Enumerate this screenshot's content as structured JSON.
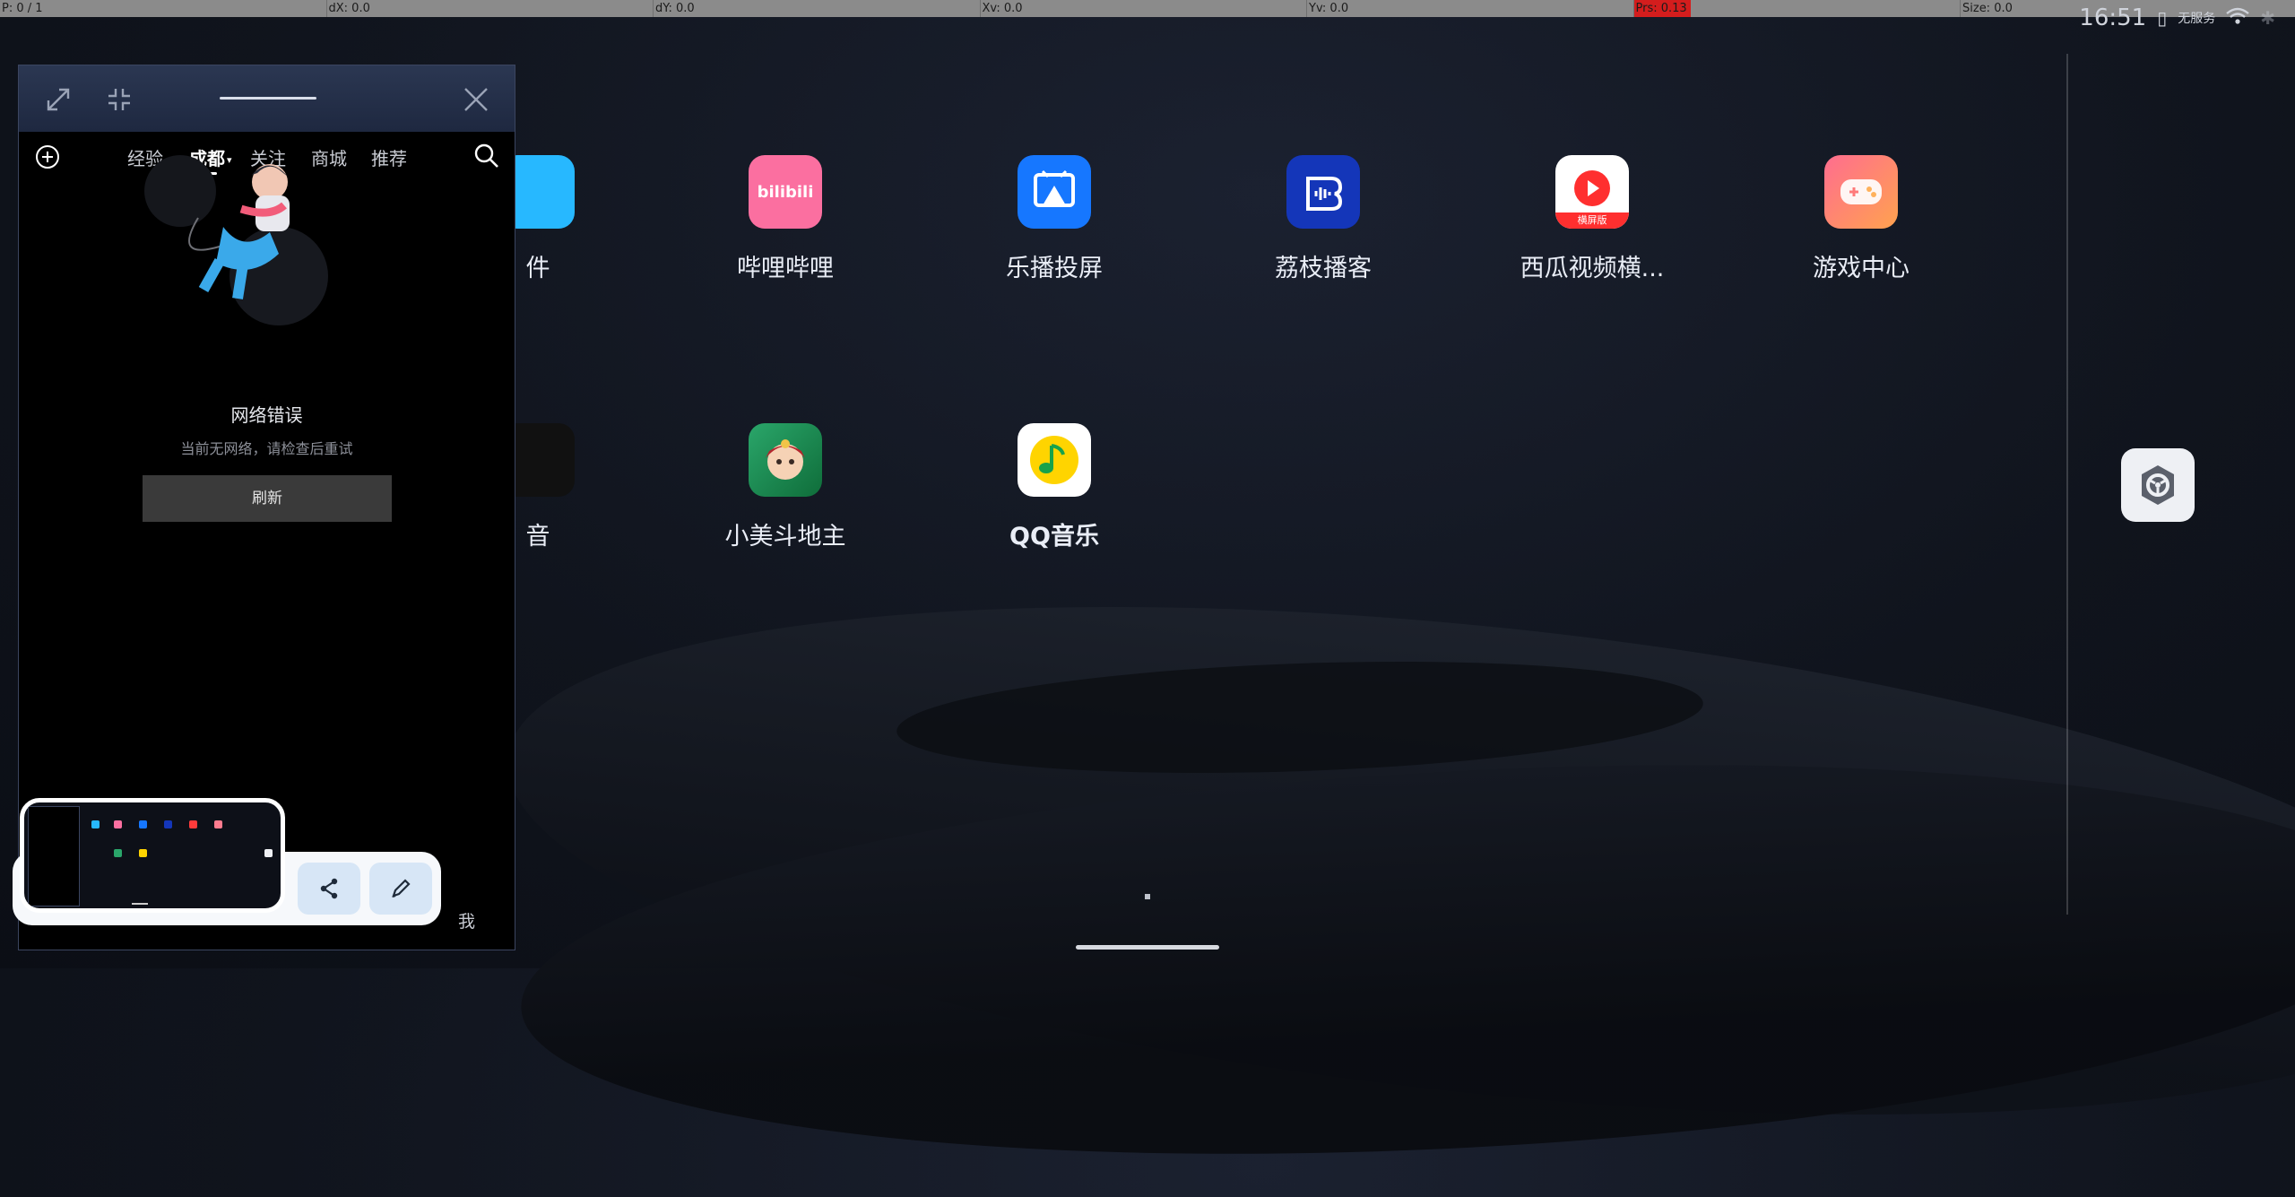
{
  "debug_bar": {
    "p": "P: 0 / 1",
    "dx": "dX: 0.0",
    "dy": "dY: 0.0",
    "xv": "Xv: 0.0",
    "yv": "Yv: 0.0",
    "prs": "Prs: 0.13",
    "size": "Size: 0.0"
  },
  "status_bar": {
    "time": "16:51",
    "carrier": "无服务"
  },
  "apps_row1": [
    {
      "label": "件",
      "icon": "files-icon"
    },
    {
      "label": "哔哩哔哩",
      "icon": "bilibili-icon"
    },
    {
      "label": "乐播投屏",
      "icon": "lebo-icon"
    },
    {
      "label": "荔枝播客",
      "icon": "lizhi-icon"
    },
    {
      "label": "西瓜视频横...",
      "icon": "xigua-icon"
    },
    {
      "label": "游戏中心",
      "icon": "game-center-icon"
    }
  ],
  "apps_row2": [
    {
      "label": "音",
      "icon": "douyin-icon"
    },
    {
      "label": "小美斗地主",
      "icon": "doudizhu-icon"
    },
    {
      "label": "QQ音乐",
      "icon": "qq-music-icon"
    }
  ],
  "app_badges": {
    "bilibili": "bilibili",
    "xigua": "横屏版"
  },
  "floating_window": {
    "tabs": [
      "经验",
      "成都",
      "关注",
      "商城",
      "推荐"
    ],
    "error_title": "网络错误",
    "error_sub": "当前无网络，请检查后重试",
    "refresh_label": "刷新",
    "bottom_me": "我"
  },
  "colors": {
    "accent_blue": "#1677ff",
    "bilibili_pink": "#fb6fa0",
    "window_title": "#2b3752"
  }
}
